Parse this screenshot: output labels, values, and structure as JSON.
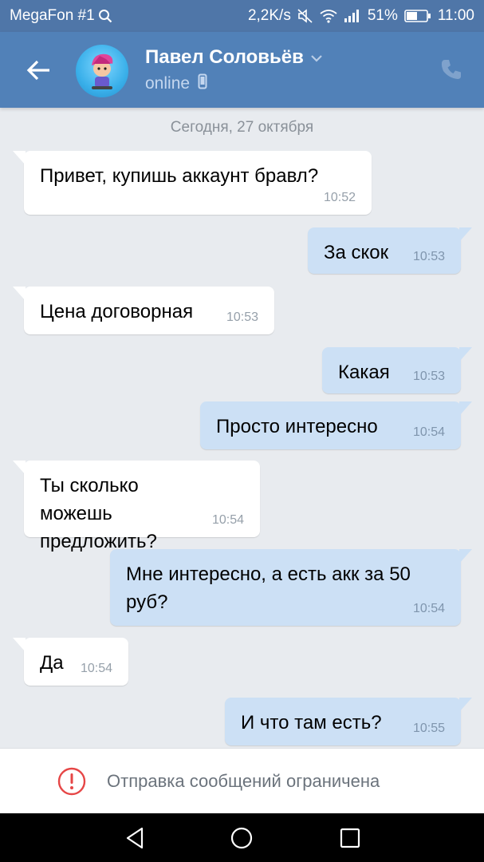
{
  "statusbar": {
    "carrier": "MegaFon #1",
    "speed": "2,2K/s",
    "battery": "51%",
    "time": "11:00"
  },
  "header": {
    "name": "Павел Соловьёв",
    "status": "online"
  },
  "chat": {
    "date": "Сегодня, 27 октября",
    "messages": [
      {
        "dir": "in",
        "text": "Привет, купишь аккаунт бравл?",
        "time": "10:52"
      },
      {
        "dir": "out",
        "text": "За скок",
        "time": "10:53"
      },
      {
        "dir": "in",
        "text": "Цена договорная",
        "time": "10:53"
      },
      {
        "dir": "out",
        "text": "Какая",
        "time": "10:53"
      },
      {
        "dir": "out",
        "text": "Просто интересно",
        "time": "10:54"
      },
      {
        "dir": "in",
        "text": "Ты сколько можешь предложить?",
        "time": "10:54"
      },
      {
        "dir": "out",
        "text": "Мне интересно, а есть акк за 50 руб?",
        "time": "10:54"
      },
      {
        "dir": "in",
        "text": "Да",
        "time": "10:54"
      },
      {
        "dir": "out",
        "text": "И что там есть?",
        "time": "10:55"
      }
    ]
  },
  "restricted": {
    "text": "Отправка сообщений ограничена"
  },
  "colors": {
    "header": "#5181b8",
    "statusbar": "#4f76a8",
    "out_bubble": "#cce0f5",
    "in_bubble": "#ffffff",
    "chat_bg": "#e8ebef",
    "warning": "#e64646"
  }
}
